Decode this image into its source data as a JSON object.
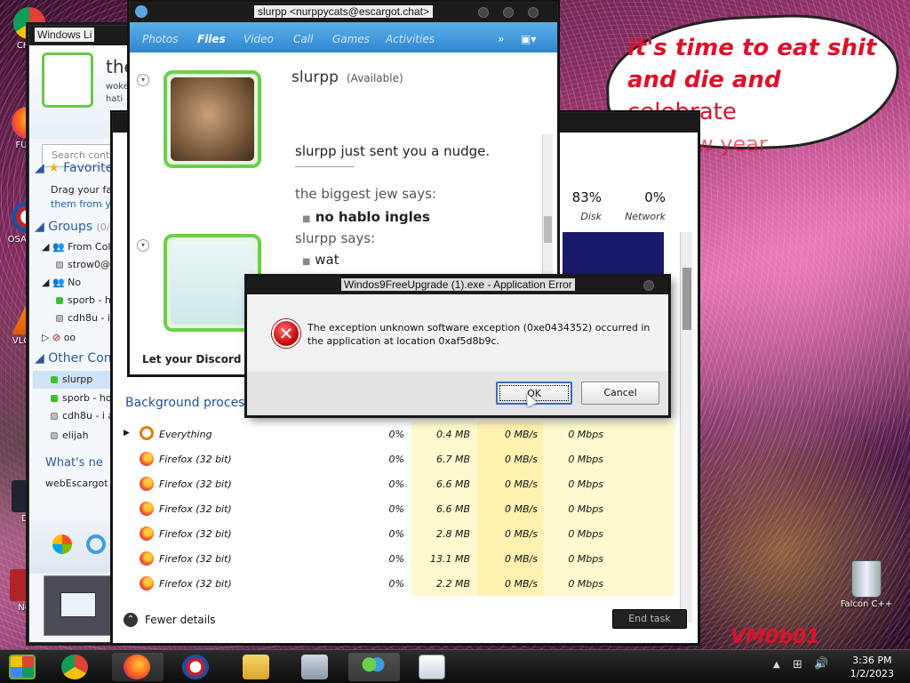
{
  "desktop": {
    "icons": [
      {
        "label": "CH\nDI",
        "name": "chrome-desktop-icon"
      },
      {
        "label": "FURR",
        "name": "firefox-desktop-icon"
      },
      {
        "label": "OSA\nLAD",
        "name": "obama-desktop-icon"
      },
      {
        "label": "VLC\nPL",
        "name": "vlc-desktop-icon"
      },
      {
        "label": "Do",
        "name": "doc-desktop-icon"
      },
      {
        "label": "Not",
        "name": "notepad-desktop-icon"
      }
    ],
    "recycle_label": "Falcon C++",
    "bubble_line1": "it's time to eat shit",
    "bubble_line2a": "and die and",
    "bubble_line2b": "celebrate",
    "bubble_line3": "the new year",
    "wallpaper_text": "VM0b01"
  },
  "wlm": {
    "title": "Windows Li",
    "user_name": "the",
    "user_status_1": "woke",
    "user_status_2": "hati",
    "search_placeholder": "Search cont",
    "favorites_label": "Favorite",
    "favorites_hint_1": "Drag your fa",
    "favorites_hint_2": "them from y",
    "groups_label": "Groups",
    "groups_count": "(0/3",
    "group_from": "From Coll",
    "contact_strow": "strow0@",
    "group_no": "No",
    "contact_sporb": "sporb - ha",
    "contact_cdh8u": "cdh8u - i",
    "group_oo": "oo",
    "other_label": "Other Cont",
    "other_contacts": [
      {
        "name": "slurpp",
        "status": "online"
      },
      {
        "name": "sporb - hol",
        "status": "online"
      },
      {
        "name": "cdh8u - i ar",
        "status": "offline"
      },
      {
        "name": "elijah",
        "status": "offline"
      }
    ],
    "whats_new": "What's ne",
    "web_escargot": "webEscargot"
  },
  "chat": {
    "title": "slurpp <nurppycats@escargot.chat>",
    "tabs": [
      "Photos",
      "Files",
      "Video",
      "Call",
      "Games",
      "Activities"
    ],
    "active_tab": "Files",
    "more": "»",
    "contact_name": "slurpp",
    "contact_status": "(Available)",
    "nudge": "slurpp just sent you a nudge.",
    "msg1_sender": "the biggest jew says:",
    "msg1_text": "no hablo ingles",
    "msg2_sender": "slurpp says:",
    "msg2_text": "wat",
    "discord_banner": "Let your Discord fr"
  },
  "taskmgr": {
    "cpu_pct": "83%",
    "disk_label": "Disk",
    "net_pct": "0%",
    "net_label": "Network",
    "section": "Background proces",
    "processes": [
      {
        "name": "Everything",
        "cpu": "0%",
        "mem": "0.4 MB",
        "disk": "0 MB/s",
        "net": "0 Mbps"
      },
      {
        "name": "Firefox (32 bit)",
        "cpu": "0%",
        "mem": "6.7 MB",
        "disk": "0 MB/s",
        "net": "0 Mbps"
      },
      {
        "name": "Firefox (32 bit)",
        "cpu": "0%",
        "mem": "6.6 MB",
        "disk": "0 MB/s",
        "net": "0 Mbps"
      },
      {
        "name": "Firefox (32 bit)",
        "cpu": "0%",
        "mem": "6.6 MB",
        "disk": "0 MB/s",
        "net": "0 Mbps"
      },
      {
        "name": "Firefox (32 bit)",
        "cpu": "0%",
        "mem": "2.8 MB",
        "disk": "0 MB/s",
        "net": "0 Mbps"
      },
      {
        "name": "Firefox (32 bit)",
        "cpu": "0%",
        "mem": "13.1 MB",
        "disk": "0 MB/s",
        "net": "0 Mbps"
      },
      {
        "name": "Firefox (32 bit)",
        "cpu": "0%",
        "mem": "2.2 MB",
        "disk": "0 MB/s",
        "net": "0 Mbps"
      }
    ],
    "fewer_details": "Fewer details",
    "end_task": "End task"
  },
  "error": {
    "title": "Windos9FreeUpgrade (1).exe - Application Error",
    "message": "The exception unknown software exception (0xe0434352) occurred in the application at location 0xaf5d8b9c.",
    "ok": "OK",
    "cancel": "Cancel"
  },
  "taskbar": {
    "time": "3:36 PM",
    "date": "1/2/2023"
  }
}
